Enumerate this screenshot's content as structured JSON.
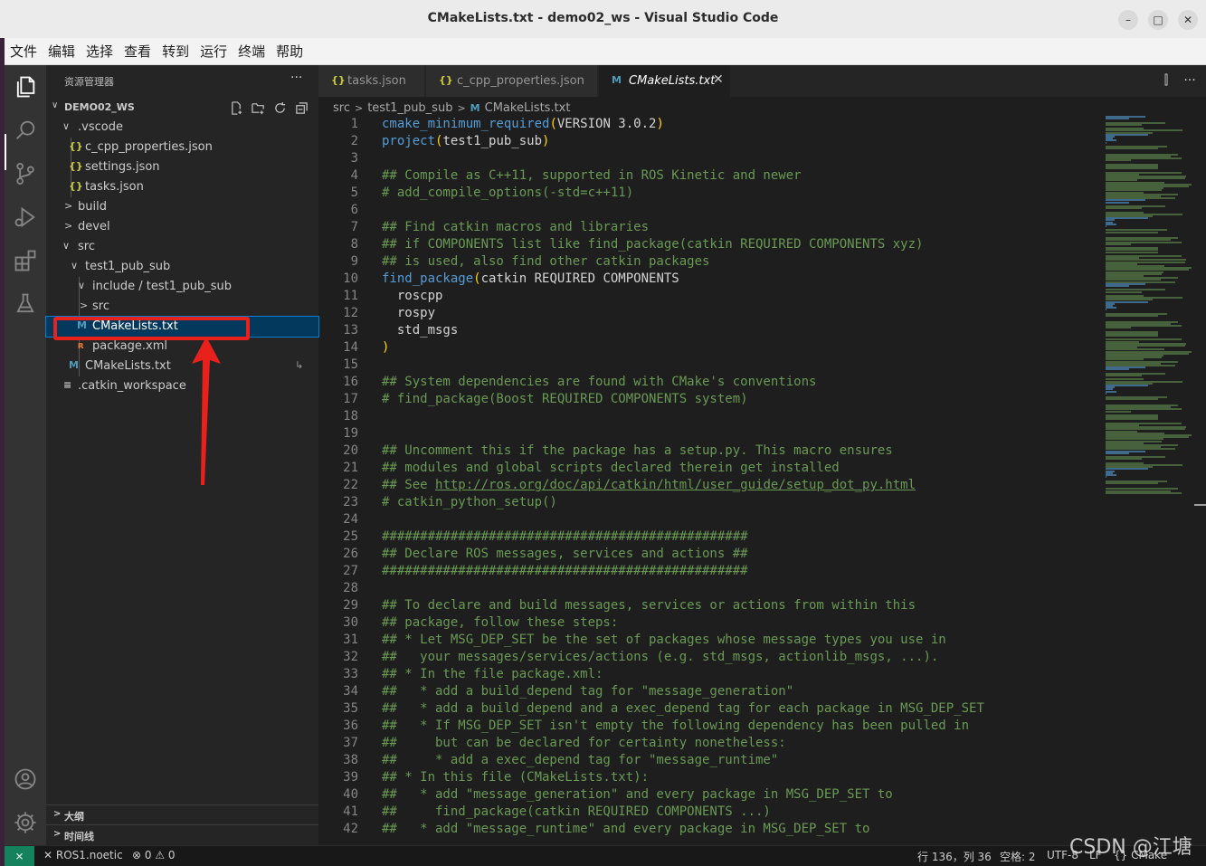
{
  "window": {
    "title": "CMakeLists.txt - demo02_ws - Visual Studio Code",
    "min_label": "–",
    "max_label": "□",
    "close_label": "✕"
  },
  "menu": [
    "文件",
    "编辑",
    "选择",
    "查看",
    "转到",
    "运行",
    "终端",
    "帮助"
  ],
  "activity_bar": {
    "top": [
      "explorer-icon",
      "search-icon",
      "source-control-icon",
      "run-debug-icon",
      "extensions-icon",
      "testing-icon"
    ],
    "bottom": [
      "account-icon",
      "settings-gear-icon"
    ]
  },
  "sidebar": {
    "header": "资源管理器",
    "more": "···",
    "workspace": "DEMO02_WS",
    "tree": [
      {
        "label": ".vscode",
        "type": "folder",
        "open": true,
        "depth": 1,
        "twisty": "∨"
      },
      {
        "label": "c_cpp_properties.json",
        "type": "json",
        "depth": 2,
        "icon": "{}"
      },
      {
        "label": "settings.json",
        "type": "json",
        "depth": 2,
        "icon": "{}"
      },
      {
        "label": "tasks.json",
        "type": "json",
        "depth": 2,
        "icon": "{}"
      },
      {
        "label": "build",
        "type": "folder",
        "open": false,
        "depth": 1,
        "twisty": ">"
      },
      {
        "label": "devel",
        "type": "folder",
        "open": false,
        "depth": 1,
        "twisty": ">"
      },
      {
        "label": "src",
        "type": "folder",
        "open": true,
        "depth": 1,
        "twisty": "∨"
      },
      {
        "label": "test1_pub_sub",
        "type": "folder",
        "open": true,
        "depth": 2,
        "twisty": "∨"
      },
      {
        "label": "include / test1_pub_sub",
        "type": "folder",
        "open": true,
        "depth": 3,
        "twisty": "∨"
      },
      {
        "label": "src",
        "type": "folder",
        "open": false,
        "depth": 3,
        "twisty": ">"
      },
      {
        "label": "CMakeLists.txt",
        "type": "cmake",
        "depth": 3,
        "icon": "M",
        "selected": true
      },
      {
        "label": "package.xml",
        "type": "xml",
        "depth": 3,
        "icon": "ʀ"
      },
      {
        "label": "CMakeLists.txt",
        "type": "cmake",
        "depth": 2,
        "icon": "M",
        "badge": "↳"
      },
      {
        "label": ".catkin_workspace",
        "type": "text",
        "depth": 1,
        "icon": "≡"
      }
    ],
    "sections": [
      {
        "label": "大纲"
      },
      {
        "label": "时间线"
      }
    ]
  },
  "tabs": [
    {
      "label": "tasks.json",
      "icon": "{}",
      "type": "json"
    },
    {
      "label": "c_cpp_properties.json",
      "icon": "{}",
      "type": "json"
    },
    {
      "label": "CMakeLists.txt",
      "icon": "M",
      "type": "cmake",
      "active": true,
      "close": "✕"
    }
  ],
  "tab_actions": [
    "⫿",
    "···"
  ],
  "breadcrumb": [
    "src",
    "test1_pub_sub",
    "CMakeLists.txt"
  ],
  "breadcrumb_sep": ">",
  "code_lines": [
    {
      "n": "1",
      "t": "cmake_minimum_required(VERSION 3.0.2)",
      "k": "call"
    },
    {
      "n": "2",
      "t": "project(test1_pub_sub)",
      "k": "call"
    },
    {
      "n": "3",
      "t": "",
      "k": "plain"
    },
    {
      "n": "4",
      "t": "## Compile as C++11, supported in ROS Kinetic and newer",
      "k": "cmt"
    },
    {
      "n": "5",
      "t": "# add_compile_options(-std=c++11)",
      "k": "cmt"
    },
    {
      "n": "6",
      "t": "",
      "k": "plain"
    },
    {
      "n": "7",
      "t": "## Find catkin macros and libraries",
      "k": "cmt"
    },
    {
      "n": "8",
      "t": "## if COMPONENTS list like find_package(catkin REQUIRED COMPONENTS xyz)",
      "k": "cmt"
    },
    {
      "n": "9",
      "t": "## is used, also find other catkin packages",
      "k": "cmt"
    },
    {
      "n": "10",
      "t": "find_package(catkin REQUIRED COMPONENTS",
      "k": "call"
    },
    {
      "n": "11",
      "t": "  roscpp",
      "k": "plain"
    },
    {
      "n": "12",
      "t": "  rospy",
      "k": "plain"
    },
    {
      "n": "13",
      "t": "  std_msgs",
      "k": "plain"
    },
    {
      "n": "14",
      "t": ")",
      "k": "paren"
    },
    {
      "n": "15",
      "t": "",
      "k": "plain"
    },
    {
      "n": "16",
      "t": "## System dependencies are found with CMake's conventions",
      "k": "cmt"
    },
    {
      "n": "17",
      "t": "# find_package(Boost REQUIRED COMPONENTS system)",
      "k": "cmt"
    },
    {
      "n": "18",
      "t": "",
      "k": "plain"
    },
    {
      "n": "19",
      "t": "",
      "k": "plain"
    },
    {
      "n": "20",
      "t": "## Uncomment this if the package has a setup.py. This macro ensures",
      "k": "cmt"
    },
    {
      "n": "21",
      "t": "## modules and global scripts declared therein get installed",
      "k": "cmt"
    },
    {
      "n": "22",
      "t": "## See http://ros.org/doc/api/catkin/html/user_guide/setup_dot_py.html",
      "k": "link"
    },
    {
      "n": "23",
      "t": "# catkin_python_setup()",
      "k": "cmt"
    },
    {
      "n": "24",
      "t": "",
      "k": "plain"
    },
    {
      "n": "25",
      "t": "################################################",
      "k": "cmt"
    },
    {
      "n": "26",
      "t": "## Declare ROS messages, services and actions ##",
      "k": "cmt"
    },
    {
      "n": "27",
      "t": "################################################",
      "k": "cmt"
    },
    {
      "n": "28",
      "t": "",
      "k": "plain"
    },
    {
      "n": "29",
      "t": "## To declare and build messages, services or actions from within this",
      "k": "cmt"
    },
    {
      "n": "30",
      "t": "## package, follow these steps:",
      "k": "cmt"
    },
    {
      "n": "31",
      "t": "## * Let MSG_DEP_SET be the set of packages whose message types you use in",
      "k": "cmt"
    },
    {
      "n": "32",
      "t": "##   your messages/services/actions (e.g. std_msgs, actionlib_msgs, ...).",
      "k": "cmt"
    },
    {
      "n": "33",
      "t": "## * In the file package.xml:",
      "k": "cmt"
    },
    {
      "n": "34",
      "t": "##   * add a build_depend tag for \"message_generation\"",
      "k": "cmt"
    },
    {
      "n": "35",
      "t": "##   * add a build_depend and a exec_depend tag for each package in MSG_DEP_SET",
      "k": "cmt"
    },
    {
      "n": "36",
      "t": "##   * If MSG_DEP_SET isn't empty the following dependency has been pulled in",
      "k": "cmt"
    },
    {
      "n": "37",
      "t": "##     but can be declared for certainty nonetheless:",
      "k": "cmt"
    },
    {
      "n": "38",
      "t": "##     * add a exec_depend tag for \"message_runtime\"",
      "k": "cmt"
    },
    {
      "n": "39",
      "t": "## * In this file (CMakeLists.txt):",
      "k": "cmt"
    },
    {
      "n": "40",
      "t": "##   * add \"message_generation\" and every package in MSG_DEP_SET to",
      "k": "cmt"
    },
    {
      "n": "41",
      "t": "##     find_package(catkin REQUIRED COMPONENTS ...)",
      "k": "cmt"
    },
    {
      "n": "42",
      "t": "##   * add \"message_runtime\" and every package in MSG_DEP_SET to",
      "k": "cmt"
    }
  ],
  "status": {
    "remote": "⨯",
    "branch": "✕ ROS1.noetic",
    "problems": "⊗ 0 ⚠ 0",
    "position": "行 136，列 36",
    "indent": "空格: 2",
    "encoding": "UTF-8",
    "eol": "LF",
    "language": "{} CMake"
  },
  "watermark": "CSDN @江塘",
  "colors": {
    "accent": "#007fd4",
    "selection_bg": "#04395e",
    "annotation_red": "#e8211c",
    "comment": "#6a9955",
    "keyword_fn": "#569cd6"
  }
}
